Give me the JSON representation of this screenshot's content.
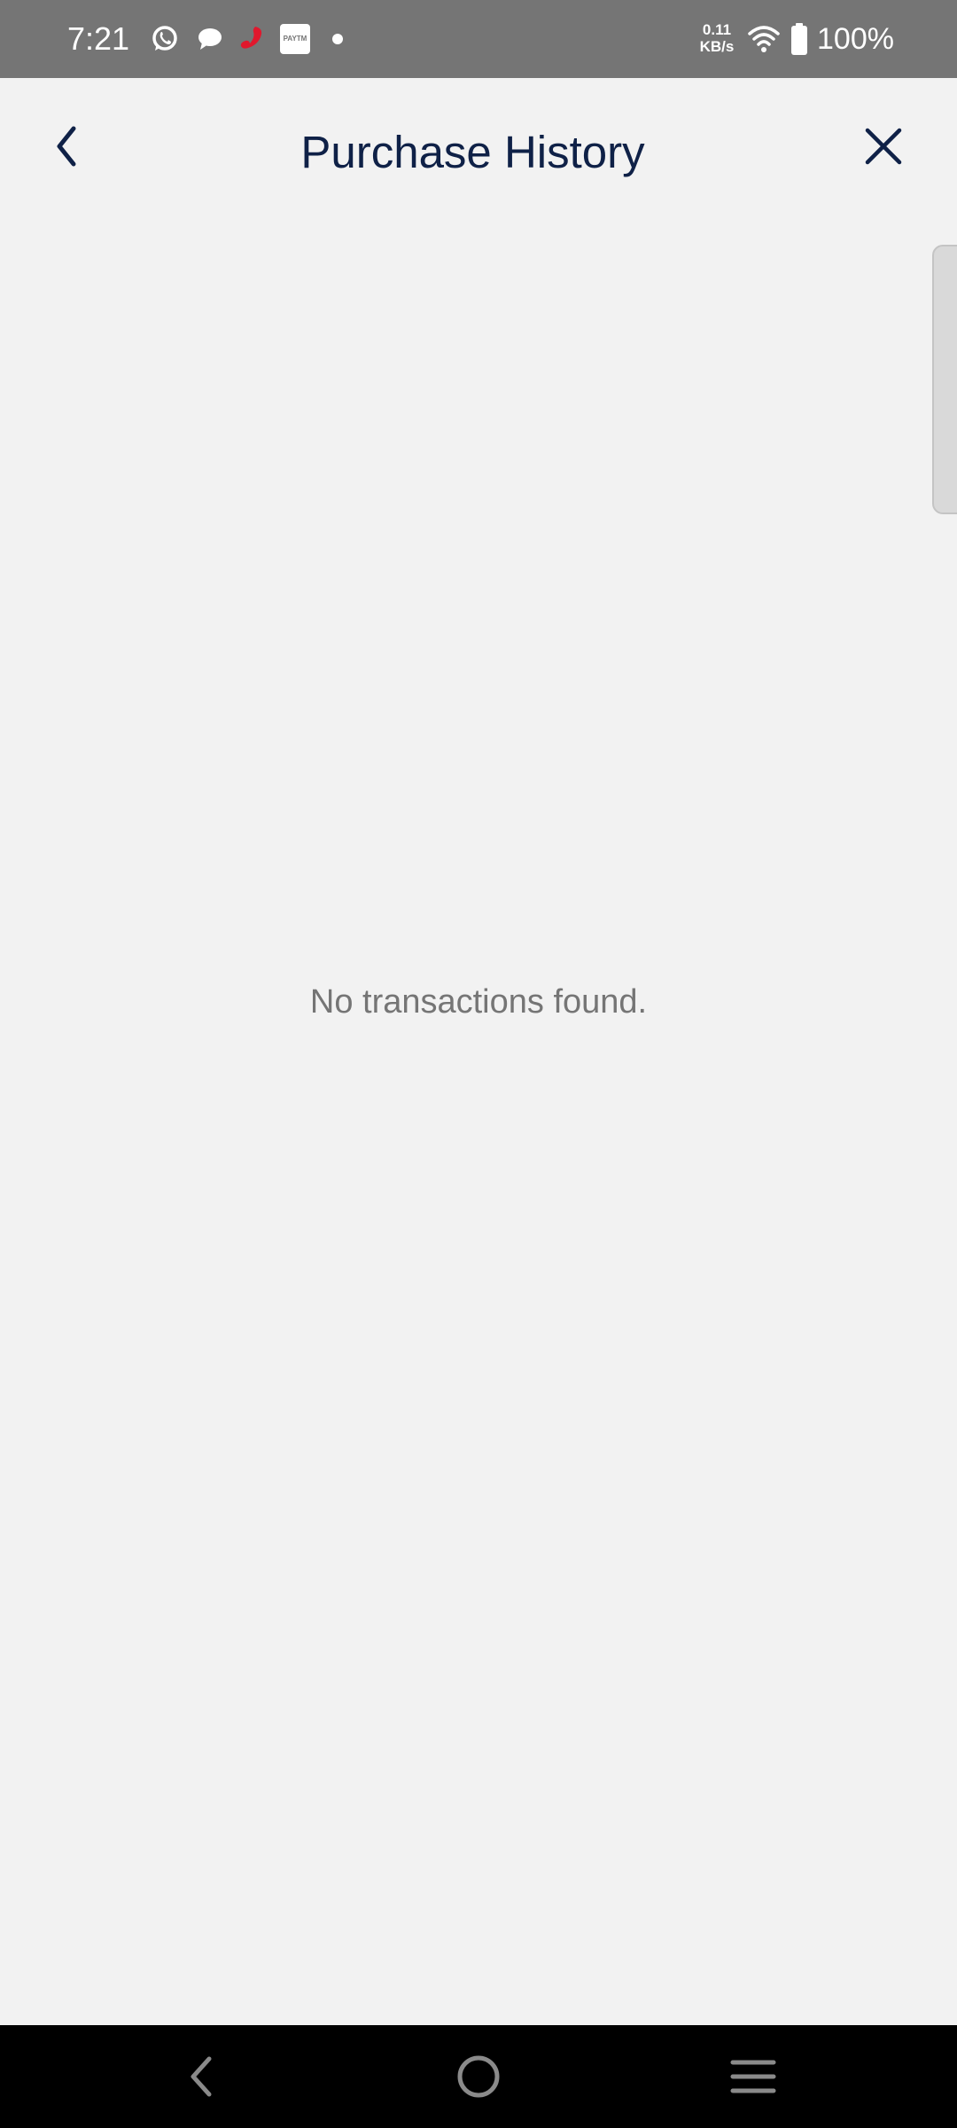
{
  "status_bar": {
    "time": "7:21",
    "network_speed_value": "0.11",
    "network_speed_unit": "KB/s",
    "battery_percent": "100%",
    "paytm_label": "PAYTM",
    "icons": [
      "whatsapp-icon",
      "chat-bubble-icon",
      "airtel-icon",
      "paytm-icon",
      "notification-dot-icon",
      "wifi-icon",
      "battery-icon"
    ]
  },
  "header": {
    "title": "Purchase History",
    "back_icon": "chevron-left-icon",
    "close_icon": "close-icon"
  },
  "main": {
    "empty_message": "No transactions found."
  },
  "nav_bar": {
    "icons": [
      "nav-back-icon",
      "nav-home-icon",
      "nav-recents-icon"
    ]
  },
  "colors": {
    "status_bar_bg": "#757575",
    "page_bg": "#f2f2f2",
    "title_color": "#0f2147",
    "empty_text_color": "#757575",
    "nav_bar_bg": "#000000",
    "airtel_red": "#e0182d"
  }
}
